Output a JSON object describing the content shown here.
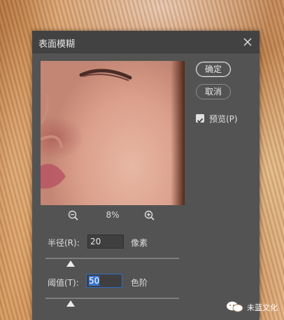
{
  "dialog": {
    "title": "表面模糊",
    "zoom": {
      "value": "8%",
      "zoom_out_icon": "zoom-out-icon",
      "zoom_in_icon": "zoom-in-icon"
    },
    "buttons": {
      "ok": "确定",
      "cancel": "取消"
    },
    "preview_checkbox": {
      "label": "预览(P)",
      "checked": true
    },
    "radius": {
      "label": "半径(R):",
      "value": "20",
      "unit": "像素",
      "slider_fraction": 0.19
    },
    "threshold": {
      "label": "阈值(T):",
      "value": "50",
      "unit": "色阶",
      "slider_fraction": 0.19
    }
  },
  "watermark": {
    "text": "未蓝文化",
    "icon": "wechat-icon"
  },
  "colors": {
    "dialog_bg": "#535353",
    "titlebar_bg": "#424242",
    "field_focus": "#2d6cc4",
    "selection": "#3a77d0"
  }
}
